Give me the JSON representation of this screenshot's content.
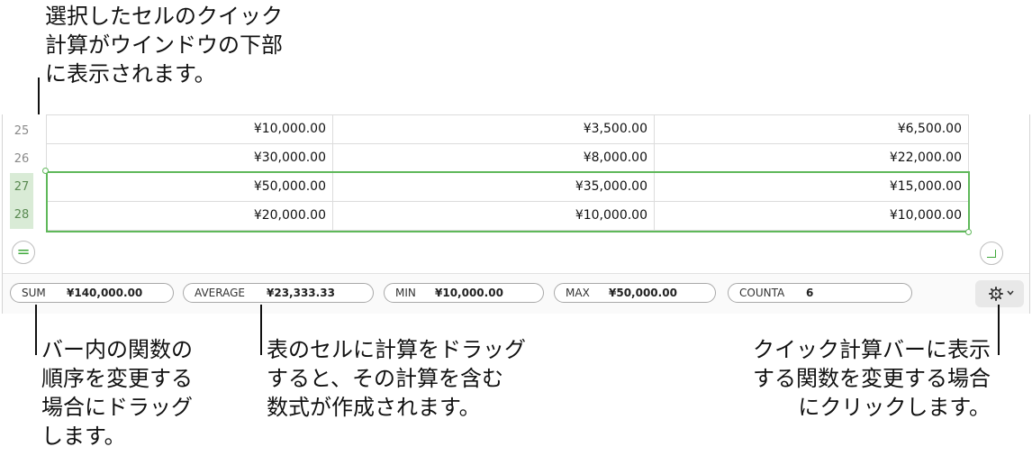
{
  "callouts": {
    "top": "選択したセルのクイック\n計算がウインドウの下部\nに表示されます。",
    "bottom_left": "バー内の関数の\n順序を変更する\n場合にドラッグ\nします。",
    "bottom_middle": "表のセルに計算をドラッグ\nすると、その計算を含む\n数式が作成されます。",
    "bottom_right": "クイック計算バーに表示\nする関数を変更する場合\nにクリックします。"
  },
  "table": {
    "rows": [
      {
        "num": "25",
        "selected": false,
        "cells": [
          "¥10,000.00",
          "¥3,500.00",
          "¥6,500.00"
        ]
      },
      {
        "num": "26",
        "selected": false,
        "cells": [
          "¥30,000.00",
          "¥8,000.00",
          "¥22,000.00"
        ]
      },
      {
        "num": "27",
        "selected": true,
        "cells": [
          "¥50,000.00",
          "¥35,000.00",
          "¥15,000.00"
        ]
      },
      {
        "num": "28",
        "selected": true,
        "cells": [
          "¥20,000.00",
          "¥10,000.00",
          "¥10,000.00"
        ]
      }
    ],
    "selection_color": "#5fb85a"
  },
  "buttons": {
    "equals_label": "=",
    "equals_icon": "equals-icon",
    "corner_icon": "corner-resize-icon",
    "gear_icon": "gear-icon",
    "chevron_icon": "chevron-down-icon"
  },
  "quick_bar": {
    "items": [
      {
        "fn": "SUM",
        "value": "¥140,000.00"
      },
      {
        "fn": "AVERAGE",
        "value": "¥23,333.33"
      },
      {
        "fn": "MIN",
        "value": "¥10,000.00"
      },
      {
        "fn": "MAX",
        "value": "¥50,000.00"
      },
      {
        "fn": "COUNTA",
        "value": "6"
      }
    ]
  }
}
